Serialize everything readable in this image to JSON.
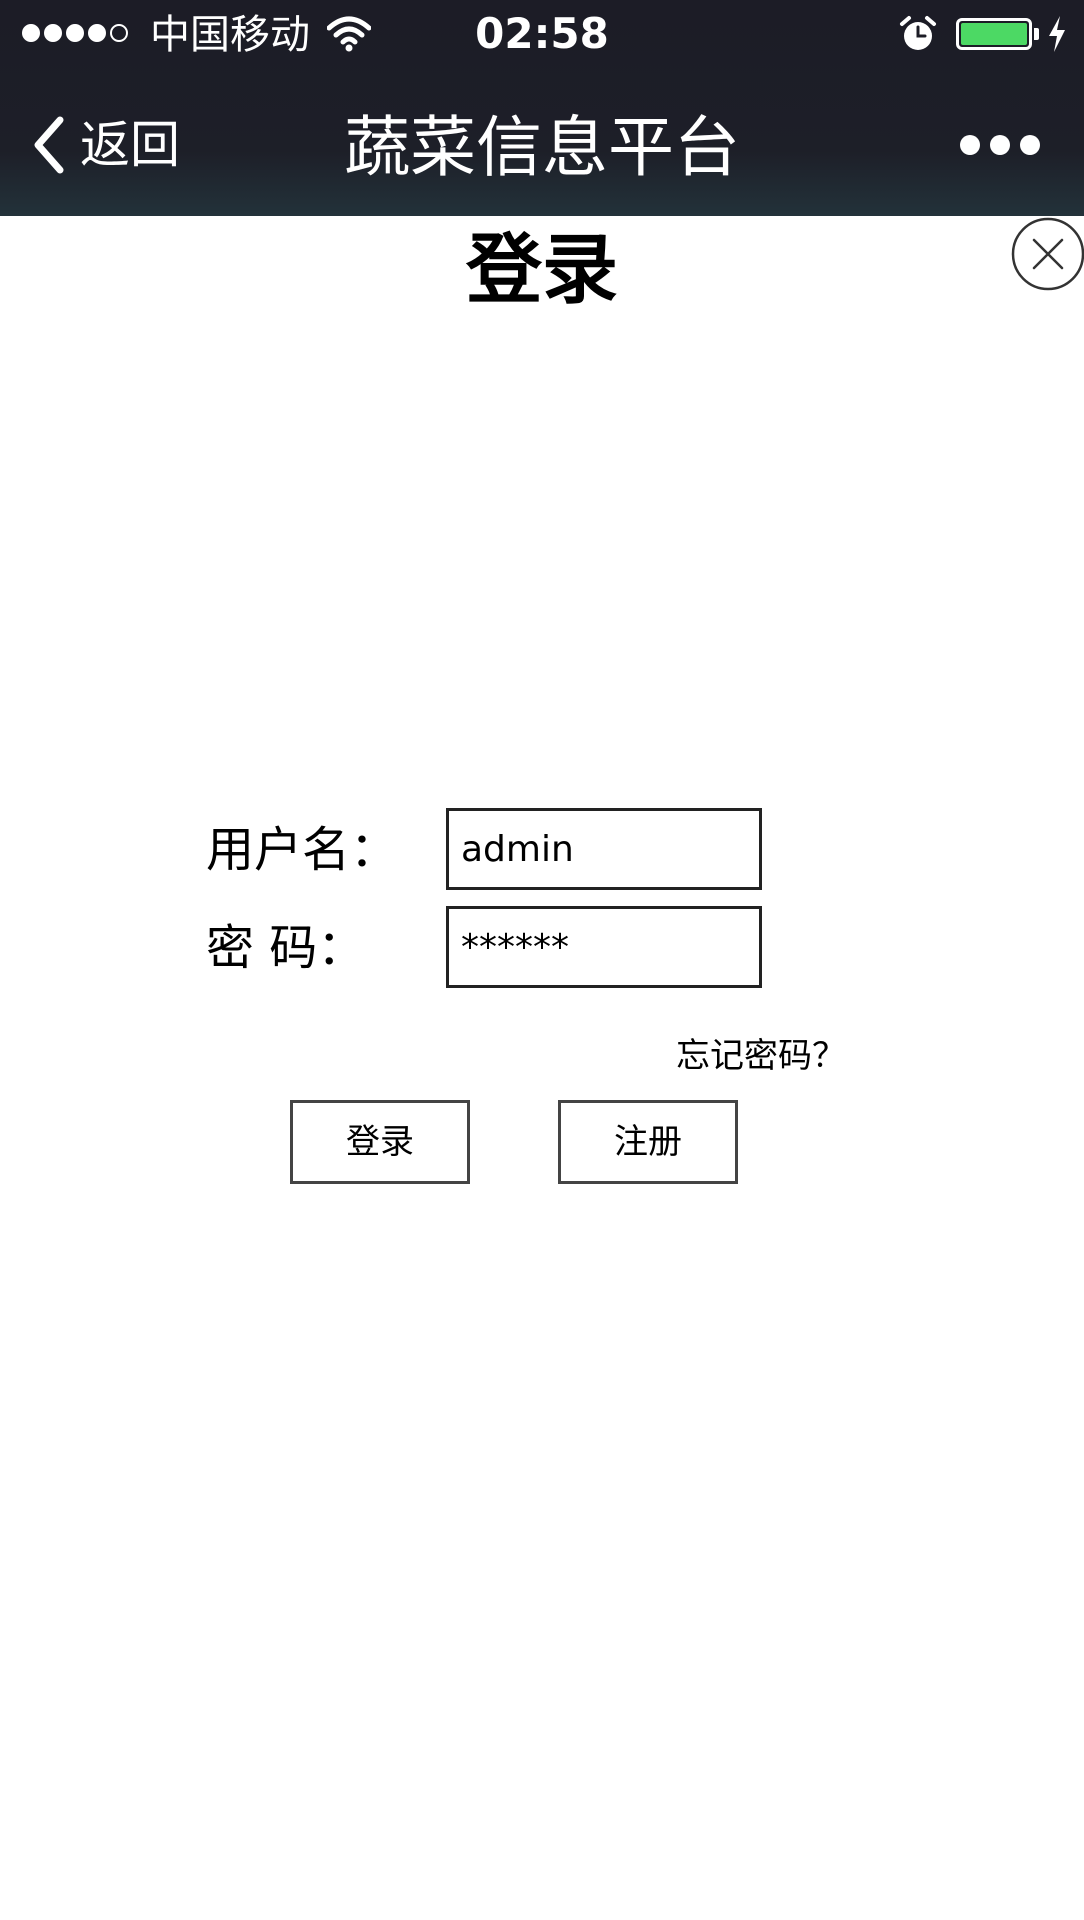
{
  "status_bar": {
    "carrier": "中国移动",
    "time": "02:58",
    "battery_color": "#4cd964",
    "icons": [
      "signal-dots-icon",
      "wifi-icon",
      "alarm-icon",
      "battery-icon",
      "charging-bolt-icon"
    ]
  },
  "nav": {
    "back_label": "返回",
    "title": "蔬菜信息平台",
    "icons": [
      "chevron-left-icon",
      "more-dots-icon"
    ]
  },
  "page": {
    "heading": "登录",
    "close_icon": "close-circle-icon"
  },
  "form": {
    "username_label": "用户名：",
    "username_value": "admin",
    "password_label": "密 码：",
    "password_value": "******",
    "forgot_link": "忘记密码？"
  },
  "buttons": {
    "login": "登录",
    "register": "注册"
  }
}
